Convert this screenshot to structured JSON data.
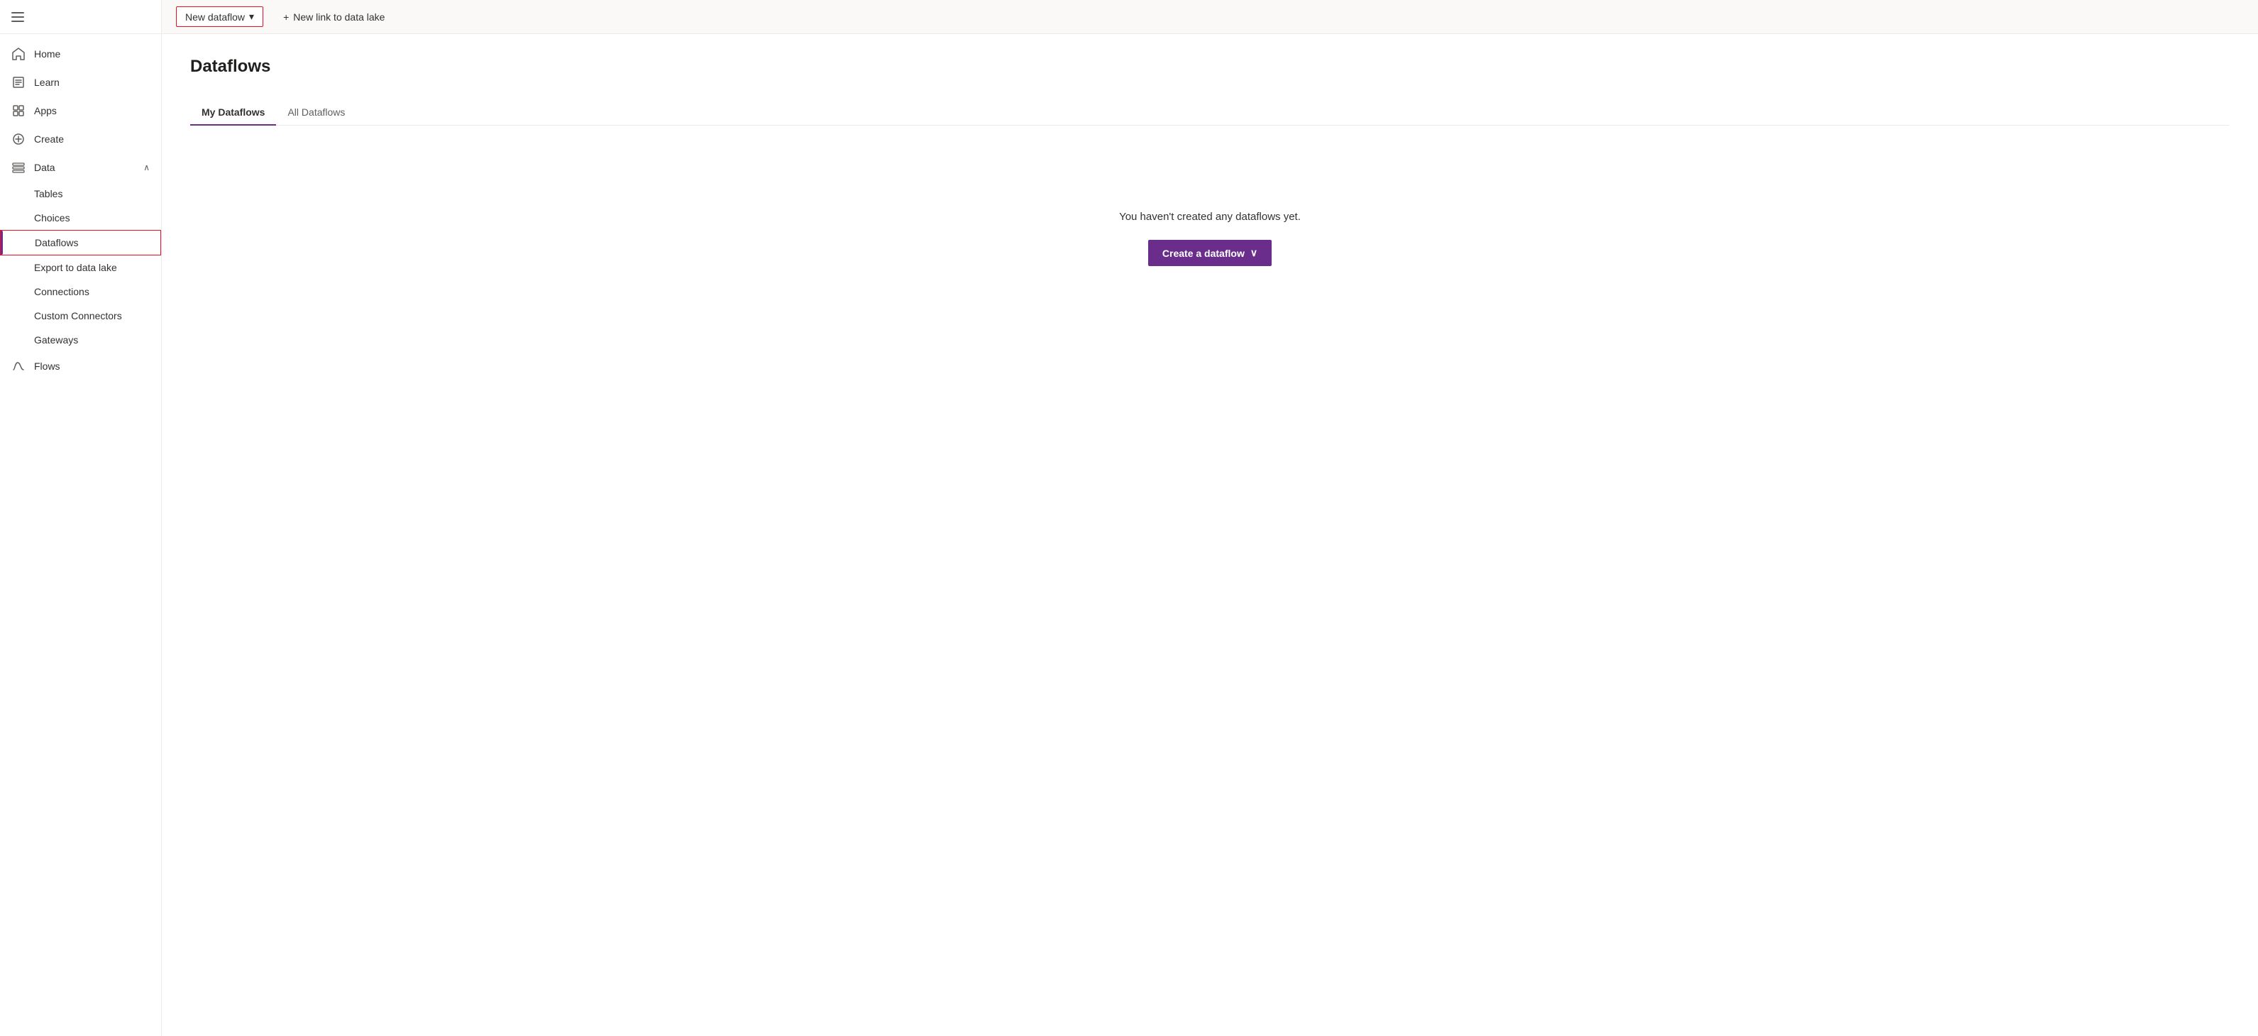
{
  "sidebar": {
    "hamburger_label": "Menu",
    "items": [
      {
        "id": "home",
        "label": "Home",
        "icon": "home",
        "type": "nav",
        "active": false
      },
      {
        "id": "learn",
        "label": "Learn",
        "icon": "book",
        "type": "nav",
        "active": false
      },
      {
        "id": "apps",
        "label": "Apps",
        "icon": "apps",
        "type": "nav",
        "active": false
      },
      {
        "id": "create",
        "label": "Create",
        "icon": "plus",
        "type": "nav",
        "active": false
      },
      {
        "id": "data",
        "label": "Data",
        "icon": "data",
        "type": "nav-parent",
        "expanded": true,
        "active": false
      }
    ],
    "sub_items": [
      {
        "id": "tables",
        "label": "Tables",
        "active": false
      },
      {
        "id": "choices",
        "label": "Choices",
        "active": false
      },
      {
        "id": "dataflows",
        "label": "Dataflows",
        "active": true
      },
      {
        "id": "export-to-data-lake",
        "label": "Export to data lake",
        "active": false
      },
      {
        "id": "connections",
        "label": "Connections",
        "active": false
      },
      {
        "id": "custom-connectors",
        "label": "Custom Connectors",
        "active": false
      },
      {
        "id": "gateways",
        "label": "Gateways",
        "active": false
      }
    ],
    "bottom_items": [
      {
        "id": "flows",
        "label": "Flows",
        "icon": "flows",
        "active": false
      }
    ]
  },
  "toolbar": {
    "new_dataflow_label": "New dataflow",
    "new_dataflow_chevron": "▾",
    "new_link_label": "New link to data lake",
    "new_link_icon": "+"
  },
  "main": {
    "page_title": "Dataflows",
    "tabs": [
      {
        "id": "my-dataflows",
        "label": "My Dataflows",
        "active": true
      },
      {
        "id": "all-dataflows",
        "label": "All Dataflows",
        "active": false
      }
    ],
    "empty_state": {
      "message": "You haven't created any dataflows yet.",
      "create_button_label": "Create a dataflow",
      "create_button_chevron": "∨"
    }
  },
  "colors": {
    "accent": "#6b2d8b",
    "active_border": "#e81123",
    "active_tab_underline": "#6b2d8b"
  }
}
